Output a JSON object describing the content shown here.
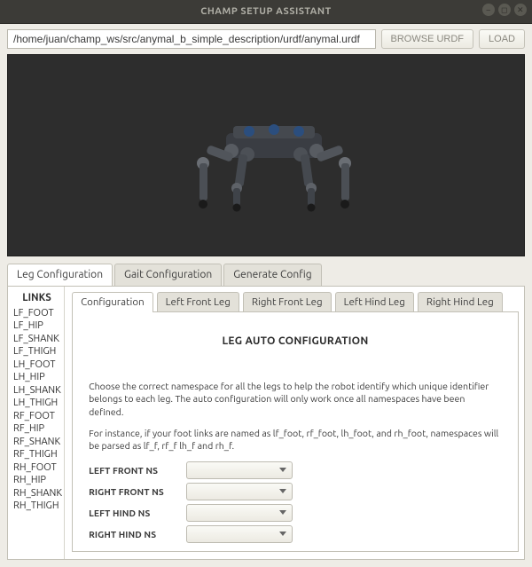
{
  "window": {
    "title": "CHAMP SETUP ASSISTANT"
  },
  "toolbar": {
    "path_value": "/home/juan/champ_ws/src/anymal_b_simple_description/urdf/anymal.urdf",
    "browse_label": "BROWSE URDF",
    "load_label": "LOAD"
  },
  "outer_tabs": {
    "leg": "Leg Configuration",
    "gait": "Gait Configuration",
    "gen": "Generate Config"
  },
  "links": {
    "title": "LINKS",
    "items": [
      "LF_FOOT",
      "LF_HIP",
      "LF_SHANK",
      "LF_THIGH",
      "LH_FOOT",
      "LH_HIP",
      "LH_SHANK",
      "LH_THIGH",
      "RF_FOOT",
      "RF_HIP",
      "RF_SHANK",
      "RF_THIGH",
      "RH_FOOT",
      "RH_HIP",
      "RH_SHANK",
      "RH_THIGH"
    ]
  },
  "inner_tabs": {
    "config": "Configuration",
    "lf": "Left Front Leg",
    "rf": "Right Front Leg",
    "lh": "Left Hind Leg",
    "rh": "Right Hind Leg"
  },
  "config_panel": {
    "title": "LEG AUTO CONFIGURATION",
    "desc1": "Choose the correct namespace for all the legs to help the robot identify which unique identifier belongs to each leg. The auto configuration will only work once all namespaces have been defined.",
    "desc2": "For instance, if your foot links are named as lf_foot, rf_foot, lh_foot, and rh_foot, namespaces will be parsed as lf_f, rf_f lh_f and rh_f.",
    "rows": {
      "lf": {
        "label": "LEFT FRONT NS",
        "value": ""
      },
      "rf": {
        "label": "RIGHT FRONT NS",
        "value": ""
      },
      "lh": {
        "label": "LEFT HIND NS",
        "value": ""
      },
      "rh": {
        "label": "RIGHT HIND NS",
        "value": ""
      }
    }
  }
}
